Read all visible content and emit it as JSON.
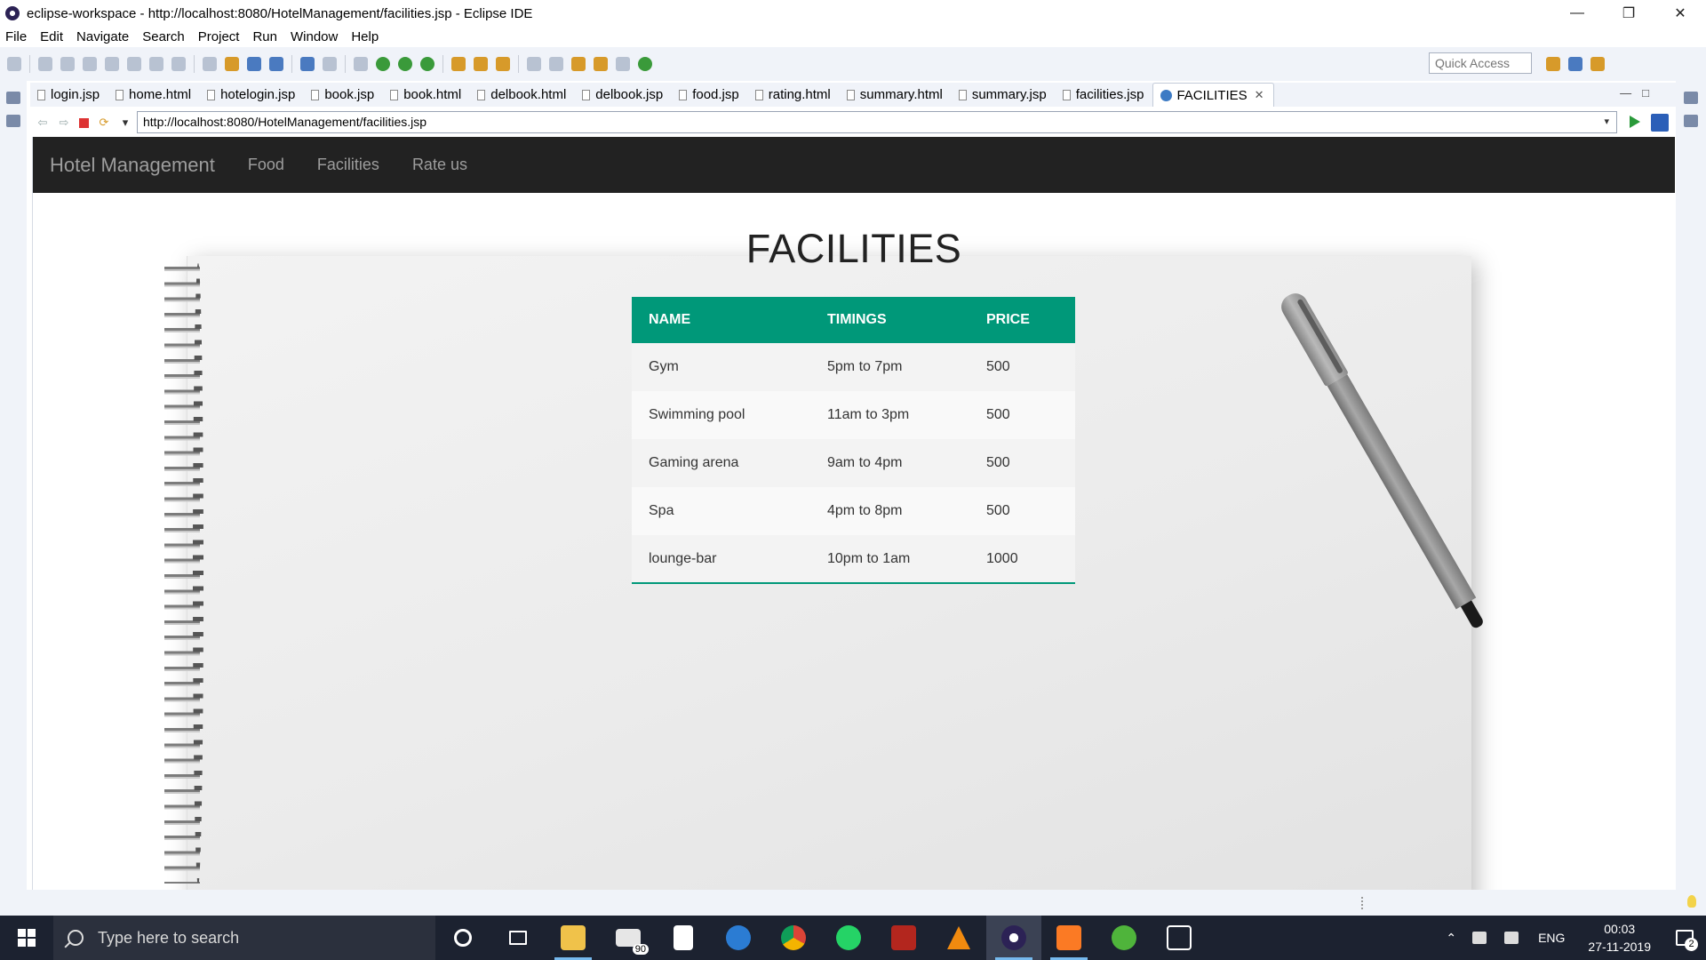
{
  "window": {
    "title": "eclipse-workspace - http://localhost:8080/HotelManagement/facilities.jsp - Eclipse IDE",
    "minimize_glyph": "—",
    "restore_glyph": "❐",
    "close_glyph": "✕"
  },
  "menu": [
    "File",
    "Edit",
    "Navigate",
    "Search",
    "Project",
    "Run",
    "Window",
    "Help"
  ],
  "toolbar": {
    "quick_access_placeholder": "Quick Access"
  },
  "tabs": [
    {
      "label": "login.jsp"
    },
    {
      "label": "home.html"
    },
    {
      "label": "hotelogin.jsp"
    },
    {
      "label": "book.jsp"
    },
    {
      "label": "book.html"
    },
    {
      "label": "delbook.html"
    },
    {
      "label": "delbook.jsp"
    },
    {
      "label": "food.jsp"
    },
    {
      "label": "rating.html"
    },
    {
      "label": "summary.html"
    },
    {
      "label": "summary.jsp"
    },
    {
      "label": "facilities.jsp"
    },
    {
      "label": "FACILITIES",
      "active": true
    }
  ],
  "browser": {
    "url": "http://localhost:8080/HotelManagement/facilities.jsp"
  },
  "site": {
    "brand": "Hotel Management",
    "nav": [
      "Food",
      "Facilities",
      "Rate us"
    ],
    "heading": "FACILITIES",
    "table": {
      "headers": [
        "NAME",
        "TIMINGS",
        "PRICE"
      ],
      "rows": [
        [
          "Gym",
          "5pm to 7pm",
          "500"
        ],
        [
          "Swimming pool",
          "11am to 3pm",
          "500"
        ],
        [
          "Gaming arena",
          "9am to 4pm",
          "500"
        ],
        [
          "Spa",
          "4pm to 8pm",
          "500"
        ],
        [
          "lounge-bar",
          "10pm to 1am",
          "1000"
        ]
      ],
      "header_color": "#009879"
    }
  },
  "taskbar": {
    "search_placeholder": "Type here to search",
    "mail_badge": "90",
    "language": "ENG",
    "time": "00:03",
    "date": "27-11-2019",
    "notification_count": "2"
  }
}
